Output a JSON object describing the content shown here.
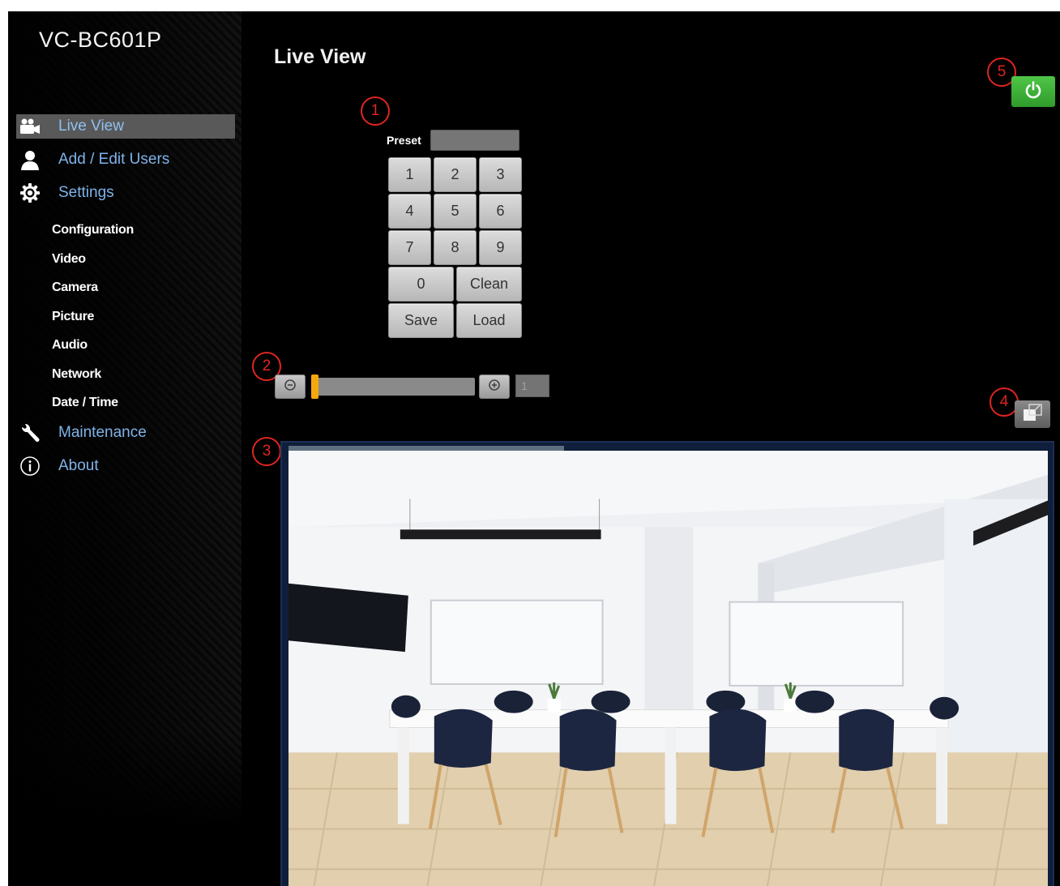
{
  "app": {
    "model": "VC-BC601P"
  },
  "page": {
    "title": "Live View"
  },
  "sidebar": {
    "items": [
      {
        "label": "Live View",
        "icon": "video-camera-icon",
        "active": true
      },
      {
        "label": "Add / Edit Users",
        "icon": "user-icon"
      },
      {
        "label": "Settings",
        "icon": "gear-icon"
      }
    ],
    "settings_sub": [
      "Configuration",
      "Video",
      "Camera",
      "Picture",
      "Audio",
      "Network",
      "Date / Time"
    ],
    "items_bottom": [
      {
        "label": "Maintenance",
        "icon": "wrench-icon"
      },
      {
        "label": "About",
        "icon": "info-icon"
      }
    ]
  },
  "preset": {
    "label": "Preset",
    "value": "",
    "keys": [
      "1",
      "2",
      "3",
      "4",
      "5",
      "6",
      "7",
      "8",
      "9",
      "0",
      "Clean",
      "Save",
      "Load"
    ]
  },
  "zoom": {
    "value": "1",
    "level": 0.0
  },
  "annotations": [
    "1",
    "2",
    "3",
    "4",
    "5"
  ],
  "colors": {
    "link": "#7fb3ea",
    "active_bg": "#595959",
    "power": "#3cb338",
    "zoom_thumb": "#f5a70e",
    "annotation": "#e0251f"
  }
}
